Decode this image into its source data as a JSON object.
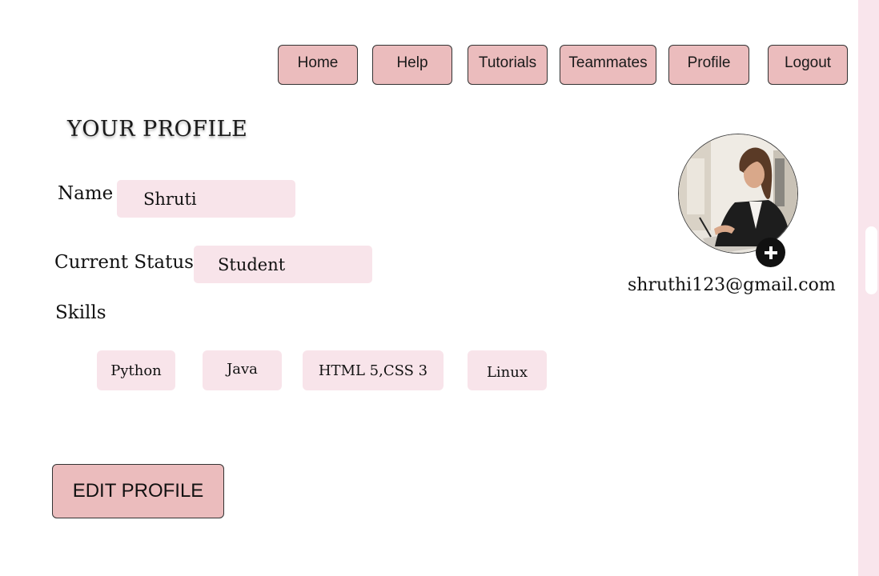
{
  "nav": {
    "items": [
      {
        "label": "Home"
      },
      {
        "label": "Help"
      },
      {
        "label": "Tutorials"
      },
      {
        "label": "Teammates"
      },
      {
        "label": "Profile"
      },
      {
        "label": "Logout"
      }
    ]
  },
  "profile": {
    "title": "YOUR PROFILE",
    "name_label": "Name",
    "name_value": "Shruti",
    "status_label": "Current Status",
    "status_value": "Student",
    "skills_label": "Skills",
    "skills": [
      "Python",
      "Java",
      "HTML 5,CSS 3",
      "Linux"
    ],
    "email": "shruthi123@gmail.com",
    "edit_label": "EDIT PROFILE"
  },
  "icons": {
    "avatar": "profile-photo",
    "add_photo": "plus-icon"
  },
  "colors": {
    "button_bg": "#ebbcbd",
    "field_bg": "#f8e4ea",
    "scrollbar": "#f9e5ec"
  }
}
